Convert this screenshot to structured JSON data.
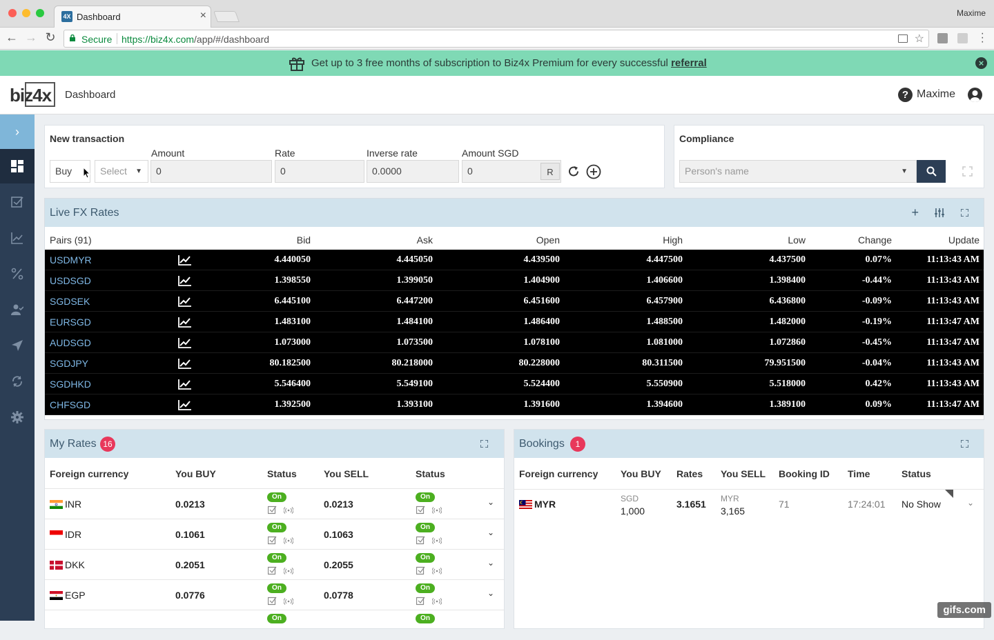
{
  "browser": {
    "tab_title": "Dashboard",
    "favicon_text": "4X",
    "user": "Maxime",
    "secure_label": "Secure",
    "url_scheme_host": "https://biz4x.com",
    "url_path": "/app/#/dashboard"
  },
  "banner": {
    "text": "Get up to 3 free months of subscription to Biz4x Premium for every successful",
    "link": "referral",
    "bg_color": "#7fd9b5"
  },
  "header": {
    "logo": "biz4x",
    "page_title": "Dashboard",
    "user": "Maxime"
  },
  "new_transaction": {
    "title": "New transaction",
    "side": "Buy",
    "currency_placeholder": "Select",
    "amount_label": "Amount",
    "amount_value": "0",
    "rate_label": "Rate",
    "rate_value": "0",
    "inverse_label": "Inverse rate",
    "inverse_value": "0.0000",
    "amount_sgd_label": "Amount SGD",
    "amount_sgd_value": "0",
    "r_button": "R"
  },
  "compliance": {
    "title": "Compliance",
    "placeholder": "Person's name"
  },
  "fx": {
    "title": "Live FX Rates",
    "columns": [
      "Pairs (91)",
      "Bid",
      "Ask",
      "Open",
      "High",
      "Low",
      "Change",
      "Update"
    ],
    "rows": [
      {
        "pair": "USDMYR",
        "bid": "4.440050",
        "ask": "4.445050",
        "open": "4.439500",
        "high": "4.447500",
        "low": "4.437500",
        "change": "0.07%",
        "update": "11:13:43 AM"
      },
      {
        "pair": "USDSGD",
        "bid": "1.398550",
        "ask": "1.399050",
        "open": "1.404900",
        "high": "1.406600",
        "low": "1.398400",
        "change": "-0.44%",
        "update": "11:13:43 AM"
      },
      {
        "pair": "SGDSEK",
        "bid": "6.445100",
        "ask": "6.447200",
        "open": "6.451600",
        "high": "6.457900",
        "low": "6.436800",
        "change": "-0.09%",
        "update": "11:13:43 AM"
      },
      {
        "pair": "EURSGD",
        "bid": "1.483100",
        "ask": "1.484100",
        "open": "1.486400",
        "high": "1.488500",
        "low": "1.482000",
        "change": "-0.19%",
        "update": "11:13:47 AM"
      },
      {
        "pair": "AUDSGD",
        "bid": "1.073000",
        "ask": "1.073500",
        "open": "1.078100",
        "high": "1.081000",
        "low": "1.072860",
        "change": "-0.45%",
        "update": "11:13:47 AM"
      },
      {
        "pair": "SGDJPY",
        "bid": "80.182500",
        "ask": "80.218000",
        "open": "80.228000",
        "high": "80.311500",
        "low": "79.951500",
        "change": "-0.04%",
        "update": "11:13:43 AM"
      },
      {
        "pair": "SGDHKD",
        "bid": "5.546400",
        "ask": "5.549100",
        "open": "5.524400",
        "high": "5.550900",
        "low": "5.518000",
        "change": "0.42%",
        "update": "11:13:43 AM"
      },
      {
        "pair": "CHFSGD",
        "bid": "1.392500",
        "ask": "1.393100",
        "open": "1.391600",
        "high": "1.394600",
        "low": "1.389100",
        "change": "0.09%",
        "update": "11:13:47 AM"
      }
    ]
  },
  "my_rates": {
    "title": "My Rates",
    "badge": "16",
    "columns": [
      "Foreign currency",
      "You BUY",
      "Status",
      "You SELL",
      "Status"
    ],
    "on_label": "On",
    "rows": [
      {
        "currency": "INR",
        "buy": "0.0213",
        "sell": "0.0213"
      },
      {
        "currency": "IDR",
        "buy": "0.1061",
        "sell": "0.1063"
      },
      {
        "currency": "DKK",
        "buy": "0.2051",
        "sell": "0.2055"
      },
      {
        "currency": "EGP",
        "buy": "0.0776",
        "sell": "0.0778"
      }
    ]
  },
  "bookings": {
    "title": "Bookings",
    "badge": "1",
    "columns": [
      "Foreign currency",
      "You BUY",
      "Rates",
      "You SELL",
      "Booking ID",
      "Time",
      "Status"
    ],
    "rows": [
      {
        "currency": "MYR",
        "buy_ccy": "SGD",
        "buy_amt": "1,000",
        "rate": "3.1651",
        "sell_ccy": "MYR",
        "sell_amt": "3,165",
        "booking_id": "71",
        "time": "17:24:01",
        "status": "No Show"
      }
    ]
  },
  "watermark": "gifs.com"
}
